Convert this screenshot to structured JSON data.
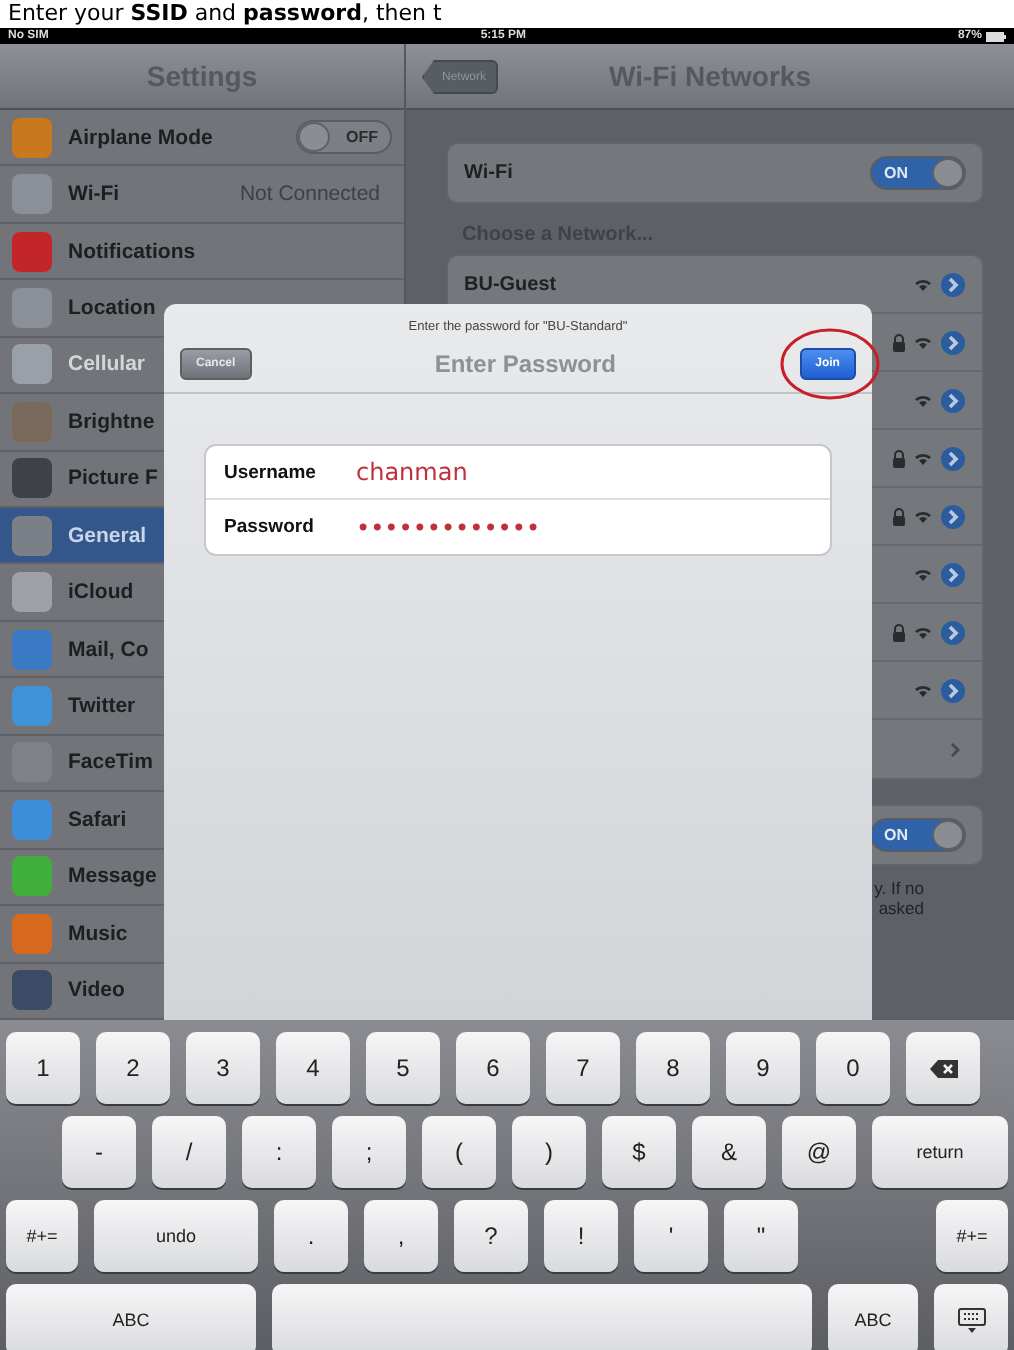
{
  "caption": "Enter your **SSID** and **password**, then t",
  "status_bar": {
    "carrier": "No SIM",
    "time": "5:15 PM",
    "battery": "87%"
  },
  "settings": {
    "title": "Settings",
    "items": [
      {
        "label": "Airplane Mode",
        "color": "#c8781e",
        "selected": false,
        "kind": "toggle",
        "toggle": {
          "label": "OFF",
          "on": false
        }
      },
      {
        "label": "Wi-Fi",
        "color": "#8a8f98",
        "selected": false,
        "kind": "value",
        "value": "Not Connected"
      },
      {
        "label": "Notifications",
        "color": "#c2262a",
        "selected": false,
        "kind": "plain"
      },
      {
        "label": "Location",
        "color": "#8a8f98",
        "selected": false,
        "kind": "plain"
      },
      {
        "label": "Cellular",
        "color": "#9aa0a8",
        "selected": false,
        "kind": "plain",
        "disabled": true
      },
      {
        "label": "Brightne",
        "color": "#7a6a5c",
        "selected": false,
        "kind": "plain"
      },
      {
        "label": "Picture F",
        "color": "#3e4248",
        "selected": false,
        "kind": "plain"
      },
      {
        "label": "General",
        "color": "#7b8088",
        "selected": true,
        "kind": "plain"
      },
      {
        "label": "iCloud",
        "color": "#9ea2a8",
        "selected": false,
        "kind": "plain"
      },
      {
        "label": "Mail, Co",
        "color": "#3a7ac4",
        "selected": false,
        "kind": "plain"
      },
      {
        "label": "Twitter",
        "color": "#3f93d6",
        "selected": false,
        "kind": "plain"
      },
      {
        "label": "FaceTim",
        "color": "#7e8288",
        "selected": false,
        "kind": "plain"
      },
      {
        "label": "Safari",
        "color": "#3c8ed8",
        "selected": false,
        "kind": "plain"
      },
      {
        "label": "Message",
        "color": "#3fae3a",
        "selected": false,
        "kind": "plain"
      },
      {
        "label": "Music",
        "color": "#d7691c",
        "selected": false,
        "kind": "plain"
      },
      {
        "label": "Video",
        "color": "#3b4a66",
        "selected": false,
        "kind": "plain"
      }
    ]
  },
  "wifi_pane": {
    "back": "Network",
    "title": "Wi-Fi Networks",
    "wifi": {
      "label": "Wi-Fi",
      "toggle": {
        "label": "ON",
        "on": true
      }
    },
    "section": "Choose a Network...",
    "networks": [
      {
        "kind": "network",
        "name": "BU-Guest",
        "locked": false
      },
      {
        "kind": "network",
        "locked": true
      },
      {
        "kind": "network",
        "locked": false
      },
      {
        "kind": "network",
        "locked": true
      },
      {
        "kind": "network",
        "locked": true
      },
      {
        "kind": "network",
        "locked": false
      },
      {
        "kind": "network",
        "locked": true
      },
      {
        "kind": "network",
        "locked": false
      },
      {
        "kind": "other"
      }
    ],
    "ask": {
      "toggle": {
        "label": "ON",
        "on": true
      },
      "footer": [
        "y. If no",
        "asked"
      ]
    }
  },
  "dialog": {
    "prompt": "Enter the password for \"BU-Standard\"",
    "title": "Enter Password",
    "cancel": "Cancel",
    "join": "Join",
    "fields": [
      {
        "label": "Username",
        "value": "chanman"
      },
      {
        "label": "Password",
        "value": "•••••••••••••"
      }
    ]
  },
  "keyboard": {
    "rows": [
      [
        {
          "kind": "char",
          "label": "1"
        },
        {
          "kind": "char",
          "label": "2"
        },
        {
          "kind": "char",
          "label": "3"
        },
        {
          "kind": "char",
          "label": "4"
        },
        {
          "kind": "char",
          "label": "5"
        },
        {
          "kind": "char",
          "label": "6"
        },
        {
          "kind": "char",
          "label": "7"
        },
        {
          "kind": "char",
          "label": "8"
        },
        {
          "kind": "char",
          "label": "9"
        },
        {
          "kind": "char",
          "label": "0"
        },
        {
          "kind": "delete"
        }
      ],
      [
        {
          "kind": "char",
          "label": "-"
        },
        {
          "kind": "char",
          "label": "/"
        },
        {
          "kind": "char",
          "label": ":"
        },
        {
          "kind": "char",
          "label": ";"
        },
        {
          "kind": "char",
          "label": "("
        },
        {
          "kind": "char",
          "label": ")"
        },
        {
          "kind": "char",
          "label": "$"
        },
        {
          "kind": "char",
          "label": "&"
        },
        {
          "kind": "char",
          "label": "@"
        },
        {
          "kind": "return",
          "label": "return"
        }
      ],
      [
        {
          "kind": "symbols",
          "label": "#+="
        },
        {
          "kind": "undo",
          "label": "undo"
        },
        {
          "kind": "char",
          "label": "."
        },
        {
          "kind": "char",
          "label": ","
        },
        {
          "kind": "char",
          "label": "?"
        },
        {
          "kind": "char",
          "label": "!"
        },
        {
          "kind": "char",
          "label": "'"
        },
        {
          "kind": "char",
          "label": "\""
        },
        {
          "kind": "symbols",
          "label": "#+="
        }
      ],
      [
        {
          "kind": "mode",
          "label": "ABC"
        },
        {
          "kind": "space"
        },
        {
          "kind": "mode",
          "label": "ABC"
        },
        {
          "kind": "dismiss"
        }
      ]
    ]
  }
}
